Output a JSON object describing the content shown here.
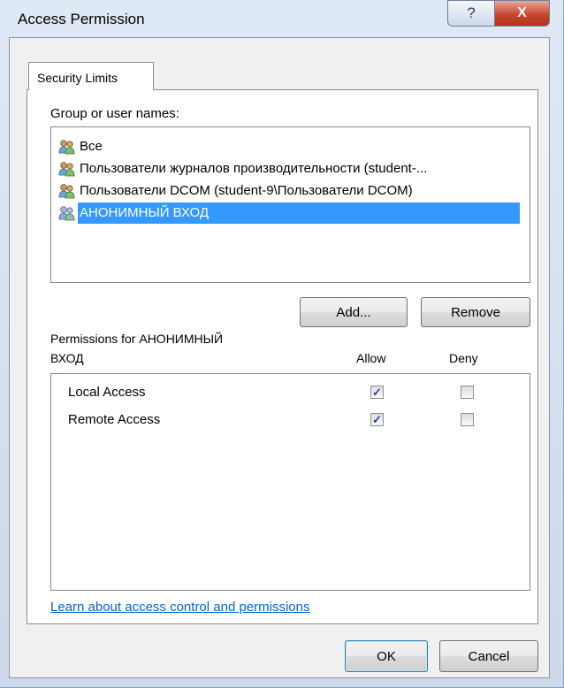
{
  "window": {
    "title": "Access Permission"
  },
  "titlebar_buttons": {
    "help": "?",
    "close": "X"
  },
  "tab": {
    "label": "Security Limits"
  },
  "group_section": {
    "label": "Group or user names:"
  },
  "users": [
    {
      "name": "Все",
      "selected": false
    },
    {
      "name": "Пользователи журналов производительности (student-...",
      "selected": false
    },
    {
      "name": "Пользователи DCOM (student-9\\Пользователи DCOM)",
      "selected": false
    },
    {
      "name": "АНОНИМНЫЙ ВХОД",
      "selected": true
    }
  ],
  "buttons": {
    "add": "Add...",
    "remove": "Remove",
    "ok": "OK",
    "cancel": "Cancel"
  },
  "permissions_section": {
    "label_line1": "Permissions for АНОНИМНЫЙ",
    "label_line2": "ВХОД",
    "allow_header": "Allow",
    "deny_header": "Deny",
    "rows": [
      {
        "name": "Local Access",
        "allow": true,
        "deny": false
      },
      {
        "name": "Remote Access",
        "allow": true,
        "deny": false
      }
    ]
  },
  "link": {
    "text": "Learn about access control and permissions"
  },
  "colors": {
    "selection": "#3399ff",
    "link": "#0066cc",
    "close_button": "#c7462f"
  },
  "icons": {
    "user_group": "users-group-icon",
    "check": "checkmark-icon"
  }
}
